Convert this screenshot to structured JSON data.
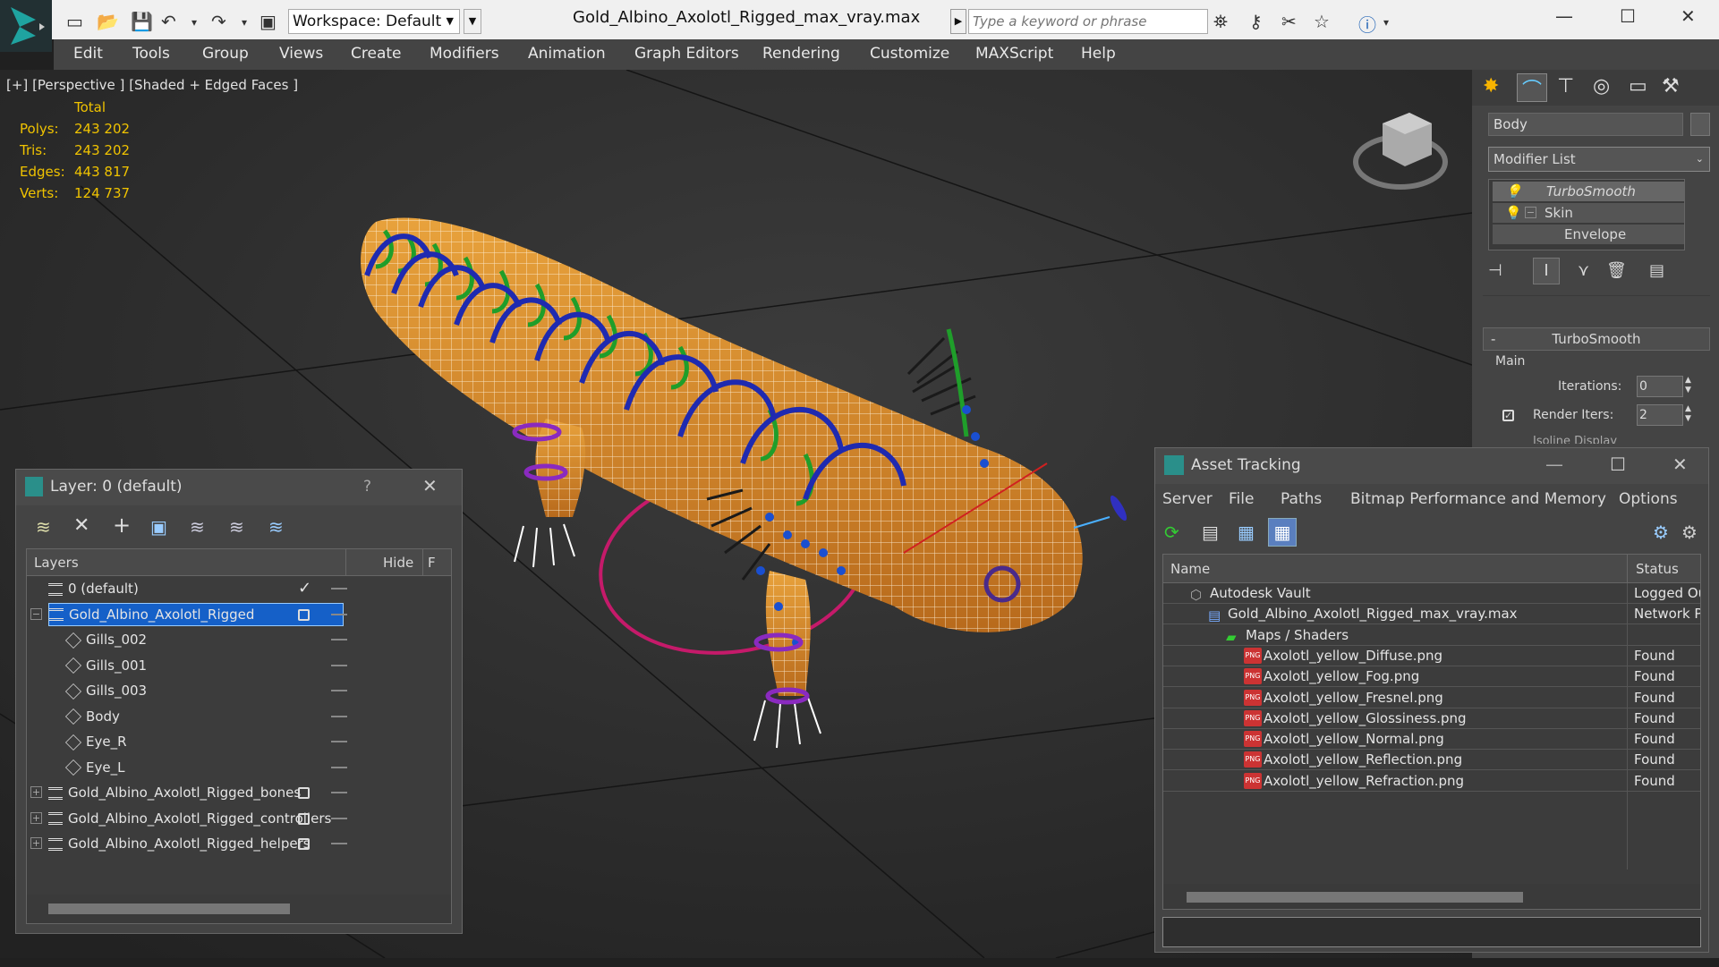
{
  "app": {
    "title": "Gold_Albino_Axolotl_Rigged_max_vray.max",
    "workspace": "Workspace: Default",
    "search_placeholder": "Type a keyword or phrase"
  },
  "menu": [
    "Edit",
    "Tools",
    "Group",
    "Views",
    "Create",
    "Modifiers",
    "Animation",
    "Graph Editors",
    "Rendering",
    "Customize",
    "MAXScript",
    "Help"
  ],
  "viewport": {
    "label_plus": "[+]",
    "label_view": "[Perspective ]",
    "label_shading": "[Shaded + Edged Faces ]",
    "stats": {
      "header": "Total",
      "polys_label": "Polys:",
      "polys": "243 202",
      "tris_label": "Tris:",
      "tris": "243 202",
      "edges_label": "Edges:",
      "edges": "443 817",
      "verts_label": "Verts:",
      "verts": "124 737"
    }
  },
  "command_panel": {
    "object_name": "Body",
    "modifier_list": "Modifier List",
    "stack": [
      "TurboSmooth",
      "Skin",
      "Envelope"
    ],
    "rollout_title": "TurboSmooth",
    "group_main": "Main",
    "iterations_label": "Iterations:",
    "iterations_value": "0",
    "render_iters_label": "Render Iters:",
    "render_iters_value": "2",
    "isoline_label": "Isoline Display"
  },
  "layer_window": {
    "title": "Layer: 0 (default)",
    "help": "?",
    "col_layers": "Layers",
    "col_hide": "Hide",
    "col_extra": "F",
    "rows": [
      {
        "name": "0 (default)",
        "kind": "layer",
        "level": 0,
        "active": true
      },
      {
        "name": "Gold_Albino_Axolotl_Rigged",
        "kind": "layer",
        "level": 0,
        "selected": true,
        "expanded": true
      },
      {
        "name": "Gills_002",
        "kind": "object",
        "level": 1
      },
      {
        "name": "Gills_001",
        "kind": "object",
        "level": 1
      },
      {
        "name": "Gills_003",
        "kind": "object",
        "level": 1
      },
      {
        "name": "Body",
        "kind": "object",
        "level": 1
      },
      {
        "name": "Eye_R",
        "kind": "object",
        "level": 1
      },
      {
        "name": "Eye_L",
        "kind": "object",
        "level": 1
      },
      {
        "name": "Gold_Albino_Axolotl_Rigged_bones",
        "kind": "layer",
        "level": 0
      },
      {
        "name": "Gold_Albino_Axolotl_Rigged_controllers",
        "kind": "layer",
        "level": 0
      },
      {
        "name": "Gold_Albino_Axolotl_Rigged_helpers",
        "kind": "layer",
        "level": 0
      }
    ]
  },
  "asset_window": {
    "title": "Asset Tracking",
    "menu": [
      "Server",
      "File",
      "Paths",
      "Bitmap Performance and Memory",
      "Options"
    ],
    "col_name": "Name",
    "col_status": "Status",
    "rows": [
      {
        "name": "Autodesk Vault",
        "status": "Logged Ou",
        "icon": "vault",
        "level": 1
      },
      {
        "name": "Gold_Albino_Axolotl_Rigged_max_vray.max",
        "status": "Network Pa",
        "icon": "max",
        "level": 2
      },
      {
        "name": "Maps / Shaders",
        "status": "",
        "icon": "maps",
        "level": 3
      },
      {
        "name": "Axolotl_yellow_Diffuse.png",
        "status": "Found",
        "icon": "png",
        "level": 4
      },
      {
        "name": "Axolotl_yellow_Fog.png",
        "status": "Found",
        "icon": "png",
        "level": 4
      },
      {
        "name": "Axolotl_yellow_Fresnel.png",
        "status": "Found",
        "icon": "png",
        "level": 4
      },
      {
        "name": "Axolotl_yellow_Glossiness.png",
        "status": "Found",
        "icon": "png",
        "level": 4
      },
      {
        "name": "Axolotl_yellow_Normal.png",
        "status": "Found",
        "icon": "png",
        "level": 4
      },
      {
        "name": "Axolotl_yellow_Reflection.png",
        "status": "Found",
        "icon": "png",
        "level": 4
      },
      {
        "name": "Axolotl_yellow_Refraction.png",
        "status": "Found",
        "icon": "png",
        "level": 4
      }
    ]
  },
  "colors": {
    "accent": "#0a6cd8",
    "stats": "#f0c300",
    "selected": "#1560c8"
  }
}
